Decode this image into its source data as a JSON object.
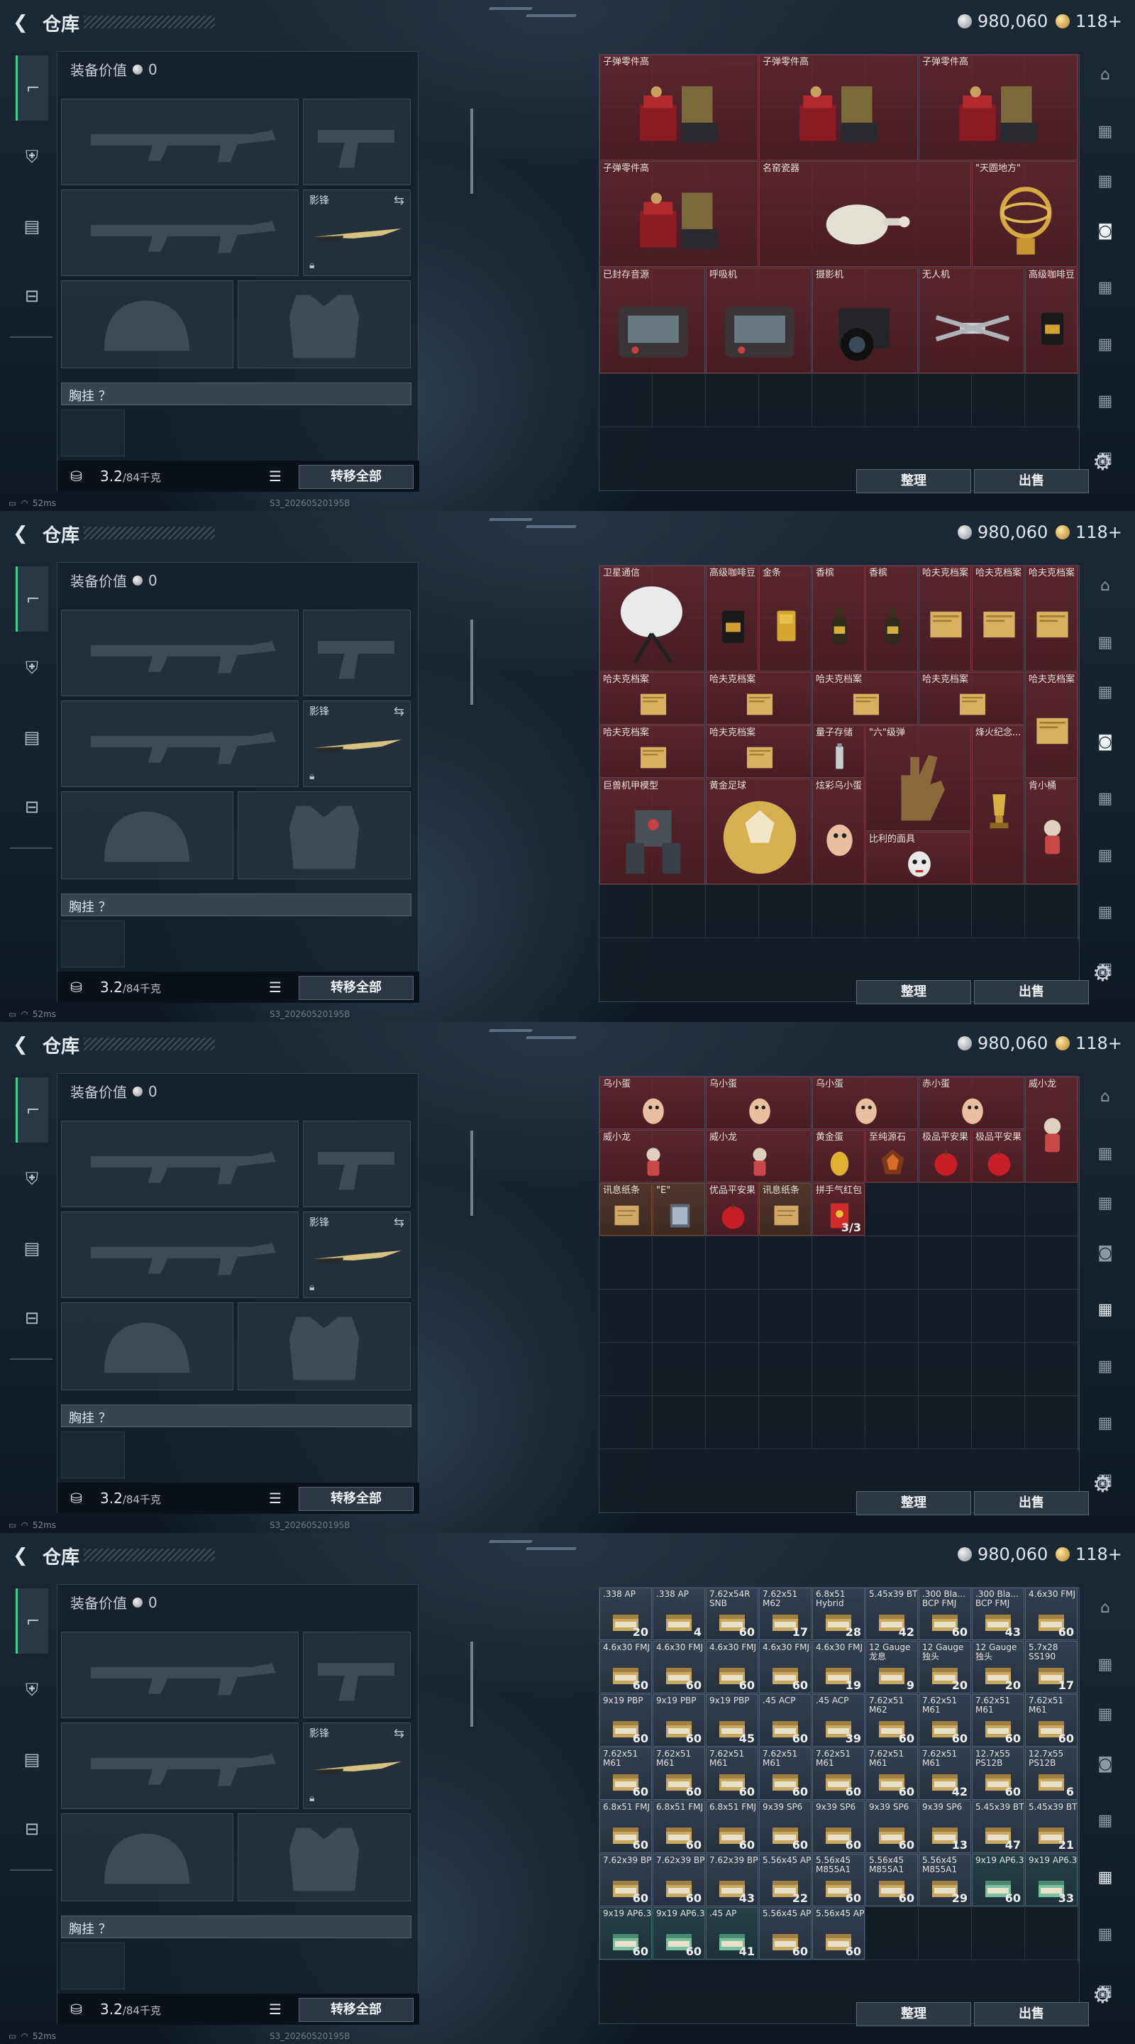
{
  "page": {
    "title": "仓库"
  },
  "currency": {
    "silver": "980,060",
    "gold": "118+"
  },
  "equipment": {
    "value_label": "装备价值",
    "value": "0",
    "melee_label": "影锋",
    "chest_label": "胸挂 ？",
    "weight": "3.2",
    "weight_max": "/84千克",
    "transfer_all": "转移全部"
  },
  "stash_buttons": {
    "organize": "整理",
    "sell": "出售"
  },
  "status": {
    "ping": "52ms",
    "build": "S3_20260520195B"
  },
  "icons": {
    "back": "back-arrow-icon",
    "tabs": [
      "weapon-icon",
      "armor-icon",
      "backpack-icon",
      "briefcase-icon"
    ],
    "right_tabs": [
      "helmet-icon",
      "tier-icon",
      "tier-icon",
      "camera-icon",
      "tier-icon",
      "tier-icon",
      "tier-icon",
      "tier-icon"
    ],
    "settings": "gear-icon"
  },
  "colors": {
    "valuable_red": "#6e2830",
    "ammo_blue": "#384658",
    "accent_green": "#3fd08a"
  },
  "screens": [
    {
      "active_right_tab": 3,
      "items": [
        {
          "name": "子弹零件高",
          "r": 0,
          "c": 0,
          "w": 3,
          "h": 2,
          "kind": "rack"
        },
        {
          "name": "子弹零件高",
          "r": 0,
          "c": 3,
          "w": 3,
          "h": 2,
          "kind": "rack"
        },
        {
          "name": "子弹零件高",
          "r": 0,
          "c": 6,
          "w": 3,
          "h": 2,
          "kind": "rack"
        },
        {
          "name": "子弹零件高",
          "r": 2,
          "c": 0,
          "w": 3,
          "h": 2,
          "kind": "rack"
        },
        {
          "name": "名窑瓷器",
          "r": 2,
          "c": 3,
          "w": 4,
          "h": 2,
          "kind": "vase"
        },
        {
          "name": "\"天圆地方\"",
          "r": 2,
          "c": 7,
          "w": 2,
          "h": 2,
          "kind": "globe"
        },
        {
          "name": "已封存音源",
          "r": 4,
          "c": 0,
          "w": 2,
          "h": 2,
          "kind": "device"
        },
        {
          "name": "呼吸机",
          "r": 4,
          "c": 2,
          "w": 2,
          "h": 2,
          "kind": "device"
        },
        {
          "name": "摄影机",
          "r": 4,
          "c": 4,
          "w": 2,
          "h": 2,
          "kind": "camera"
        },
        {
          "name": "无人机",
          "r": 4,
          "c": 6,
          "w": 2,
          "h": 2,
          "kind": "drone"
        },
        {
          "name": "高级咖啡豆",
          "r": 4,
          "c": 8,
          "w": 1,
          "h": 2,
          "kind": "bag"
        }
      ]
    },
    {
      "active_right_tab": 3,
      "items": [
        {
          "name": "卫星通信",
          "r": 0,
          "c": 0,
          "w": 2,
          "h": 2,
          "kind": "dish"
        },
        {
          "name": "高级咖啡豆",
          "r": 0,
          "c": 2,
          "w": 1,
          "h": 2,
          "kind": "bag"
        },
        {
          "name": "金条",
          "r": 0,
          "c": 3,
          "w": 1,
          "h": 2,
          "kind": "goldbar"
        },
        {
          "name": "香槟",
          "r": 0,
          "c": 4,
          "w": 1,
          "h": 2,
          "kind": "bottle"
        },
        {
          "name": "香槟",
          "r": 0,
          "c": 5,
          "w": 1,
          "h": 2,
          "kind": "bottle"
        },
        {
          "name": "哈夫克档案",
          "r": 0,
          "c": 6,
          "w": 1,
          "h": 2,
          "kind": "file"
        },
        {
          "name": "哈夫克档案",
          "r": 0,
          "c": 7,
          "w": 1,
          "h": 2,
          "kind": "file"
        },
        {
          "name": "哈夫克档案",
          "r": 0,
          "c": 8,
          "w": 1,
          "h": 2,
          "kind": "file"
        },
        {
          "name": "哈夫克档案",
          "r": 2,
          "c": 0,
          "w": 2,
          "h": 1,
          "kind": "file"
        },
        {
          "name": "哈夫克档案",
          "r": 2,
          "c": 2,
          "w": 2,
          "h": 1,
          "kind": "file"
        },
        {
          "name": "哈夫克档案",
          "r": 2,
          "c": 4,
          "w": 2,
          "h": 1,
          "kind": "file"
        },
        {
          "name": "哈夫克档案",
          "r": 2,
          "c": 6,
          "w": 2,
          "h": 1,
          "kind": "file"
        },
        {
          "name": "哈夫克档案",
          "r": 2,
          "c": 8,
          "w": 1,
          "h": 2,
          "kind": "file"
        },
        {
          "name": "哈夫克档案",
          "r": 3,
          "c": 0,
          "w": 2,
          "h": 1,
          "kind": "file"
        },
        {
          "name": "哈夫克档案",
          "r": 3,
          "c": 2,
          "w": 2,
          "h": 1,
          "kind": "file"
        },
        {
          "name": "量子存储",
          "r": 3,
          "c": 4,
          "w": 1,
          "h": 1,
          "kind": "usb"
        },
        {
          "name": "\"六\"级弹",
          "r": 3,
          "c": 5,
          "w": 2,
          "h": 2,
          "kind": "hand"
        },
        {
          "name": "烽火纪念...",
          "r": 3,
          "c": 7,
          "w": 1,
          "h": 3,
          "kind": "trophy"
        },
        {
          "name": "巨兽机甲模型",
          "r": 4,
          "c": 0,
          "w": 2,
          "h": 2,
          "kind": "mech"
        },
        {
          "name": "黄金足球",
          "r": 4,
          "c": 2,
          "w": 2,
          "h": 2,
          "kind": "ball"
        },
        {
          "name": "炫彩乌小蛋",
          "r": 4,
          "c": 4,
          "w": 1,
          "h": 2,
          "kind": "egg"
        },
        {
          "name": "比利的面具",
          "r": 5,
          "c": 5,
          "w": 2,
          "h": 1,
          "kind": "mask"
        },
        {
          "name": "肯小桶",
          "r": 4,
          "c": 8,
          "w": 1,
          "h": 2,
          "kind": "figure"
        }
      ]
    },
    {
      "active_right_tab": 4,
      "items": [
        {
          "name": "乌小蛋",
          "r": 0,
          "c": 0,
          "w": 2,
          "h": 1,
          "kind": "egg"
        },
        {
          "name": "乌小蛋",
          "r": 0,
          "c": 2,
          "w": 2,
          "h": 1,
          "kind": "egg"
        },
        {
          "name": "乌小蛋",
          "r": 0,
          "c": 4,
          "w": 2,
          "h": 1,
          "kind": "egg"
        },
        {
          "name": "赤小蛋",
          "r": 0,
          "c": 6,
          "w": 2,
          "h": 1,
          "kind": "egg"
        },
        {
          "name": "威小龙",
          "r": 0,
          "c": 8,
          "w": 1,
          "h": 2,
          "kind": "figure"
        },
        {
          "name": "威小龙",
          "r": 1,
          "c": 0,
          "w": 2,
          "h": 1,
          "kind": "figure"
        },
        {
          "name": "威小龙",
          "r": 1,
          "c": 2,
          "w": 2,
          "h": 1,
          "kind": "figure"
        },
        {
          "name": "黄金蛋",
          "r": 1,
          "c": 4,
          "w": 1,
          "h": 1,
          "kind": "goldegg"
        },
        {
          "name": "至纯源石",
          "r": 1,
          "c": 5,
          "w": 1,
          "h": 1,
          "kind": "stone"
        },
        {
          "name": "极品平安果",
          "r": 1,
          "c": 6,
          "w": 1,
          "h": 1,
          "kind": "apple"
        },
        {
          "name": "极品平安果",
          "r": 1,
          "c": 7,
          "w": 1,
          "h": 1,
          "kind": "apple"
        },
        {
          "name": "讯息纸条",
          "r": 2,
          "c": 0,
          "w": 1,
          "h": 1,
          "kind": "note"
        },
        {
          "name": "\"E\"",
          "r": 2,
          "c": 1,
          "w": 1,
          "h": 1,
          "kind": "card"
        },
        {
          "name": "优品平安果",
          "r": 2,
          "c": 2,
          "w": 1,
          "h": 1,
          "kind": "apple"
        },
        {
          "name": "讯息纸条",
          "r": 2,
          "c": 3,
          "w": 1,
          "h": 1,
          "kind": "note"
        },
        {
          "name": "拼手气红包",
          "r": 2,
          "c": 4,
          "w": 1,
          "h": 1,
          "kind": "redpacket",
          "count": "3/3"
        }
      ]
    },
    {
      "active_right_tab": 5,
      "items": [
        {
          "name": ".338 AP",
          "count": "20",
          "k": "blue"
        },
        {
          "name": ".338 AP",
          "count": "4",
          "k": "blue"
        },
        {
          "name": "7.62x54R SNB",
          "count": "60",
          "k": "blue"
        },
        {
          "name": "7.62x51 M62",
          "count": "17",
          "k": "blue"
        },
        {
          "name": "6.8x51 Hybrid",
          "count": "28",
          "k": "blue"
        },
        {
          "name": "5.45x39 BT",
          "count": "42",
          "k": "blue"
        },
        {
          "name": ".300 Bla... BCP FMJ",
          "count": "60",
          "k": "blue"
        },
        {
          "name": ".300 Bla... BCP FMJ",
          "count": "43",
          "k": "blue"
        },
        {
          "name": "4.6x30 FMJ",
          "count": "60",
          "k": "blue"
        },
        {
          "name": "4.6x30 FMJ",
          "count": "60",
          "k": "blue"
        },
        {
          "name": "4.6x30 FMJ",
          "count": "60",
          "k": "blue"
        },
        {
          "name": "4.6x30 FMJ",
          "count": "60",
          "k": "blue"
        },
        {
          "name": "4.6x30 FMJ",
          "count": "60",
          "k": "blue"
        },
        {
          "name": "4.6x30 FMJ",
          "count": "19",
          "k": "blue"
        },
        {
          "name": "12 Gauge 龙息",
          "count": "9",
          "k": "blue"
        },
        {
          "name": "12 Gauge 独头",
          "count": "20",
          "k": "blue"
        },
        {
          "name": "12 Gauge 独头",
          "count": "20",
          "k": "blue"
        },
        {
          "name": "5.7x28 SS190",
          "count": "17",
          "k": "blue"
        },
        {
          "name": "9x19 PBP",
          "count": "60",
          "k": "blue"
        },
        {
          "name": "9x19 PBP",
          "count": "60",
          "k": "blue"
        },
        {
          "name": "9x19 PBP",
          "count": "45",
          "k": "blue"
        },
        {
          "name": ".45 ACP",
          "count": "60",
          "k": "blue"
        },
        {
          "name": ".45 ACP",
          "count": "39",
          "k": "blue"
        },
        {
          "name": "7.62x51 M62",
          "count": "60",
          "k": "blue"
        },
        {
          "name": "7.62x51 M61",
          "count": "60",
          "k": "blue"
        },
        {
          "name": "7.62x51 M61",
          "count": "60",
          "k": "blue"
        },
        {
          "name": "7.62x51 M61",
          "count": "60",
          "k": "blue"
        },
        {
          "name": "7.62x51 M61",
          "count": "60",
          "k": "blue"
        },
        {
          "name": "7.62x51 M61",
          "count": "60",
          "k": "blue"
        },
        {
          "name": "7.62x51 M61",
          "count": "60",
          "k": "blue"
        },
        {
          "name": "7.62x51 M61",
          "count": "60",
          "k": "blue"
        },
        {
          "name": "7.62x51 M61",
          "count": "60",
          "k": "blue"
        },
        {
          "name": "7.62x51 M61",
          "count": "60",
          "k": "blue"
        },
        {
          "name": "7.62x51 M61",
          "count": "42",
          "k": "blue"
        },
        {
          "name": "12.7x55 PS12B",
          "count": "60",
          "k": "blue"
        },
        {
          "name": "12.7x55 PS12B",
          "count": "6",
          "k": "blue"
        },
        {
          "name": "6.8x51 FMJ",
          "count": "60",
          "k": "blue"
        },
        {
          "name": "6.8x51 FMJ",
          "count": "60",
          "k": "blue"
        },
        {
          "name": "6.8x51 FMJ",
          "count": "60",
          "k": "blue"
        },
        {
          "name": "9x39 SP6",
          "count": "60",
          "k": "blue"
        },
        {
          "name": "9x39 SP6",
          "count": "60",
          "k": "blue"
        },
        {
          "name": "9x39 SP6",
          "count": "60",
          "k": "blue"
        },
        {
          "name": "9x39 SP6",
          "count": "13",
          "k": "blue"
        },
        {
          "name": "5.45x39 BT",
          "count": "47",
          "k": "blue"
        },
        {
          "name": "5.45x39 BT",
          "count": "21",
          "k": "blue"
        },
        {
          "name": "7.62x39 BP",
          "count": "60",
          "k": "blue"
        },
        {
          "name": "7.62x39 BP",
          "count": "60",
          "k": "blue"
        },
        {
          "name": "7.62x39 BP",
          "count": "43",
          "k": "blue"
        },
        {
          "name": "5.56x45 AP",
          "count": "22",
          "k": "blue"
        },
        {
          "name": "5.56x45 M855A1",
          "count": "60",
          "k": "blue"
        },
        {
          "name": "5.56x45 M855A1",
          "count": "60",
          "k": "blue"
        },
        {
          "name": "5.56x45 M855A1",
          "count": "29",
          "k": "blue"
        },
        {
          "name": "9x19 AP6.3",
          "count": "60",
          "k": "teal"
        },
        {
          "name": "9x19 AP6.3",
          "count": "33",
          "k": "teal"
        },
        {
          "name": "9x19 AP6.3",
          "count": "60",
          "k": "teal"
        },
        {
          "name": "9x19 AP6.3",
          "count": "60",
          "k": "teal"
        },
        {
          "name": ".45 AP",
          "count": "41",
          "k": "teal"
        },
        {
          "name": "5.56x45 AP",
          "count": "60",
          "k": "blue"
        },
        {
          "name": "5.56x45 AP",
          "count": "60",
          "k": "blue"
        }
      ]
    }
  ]
}
